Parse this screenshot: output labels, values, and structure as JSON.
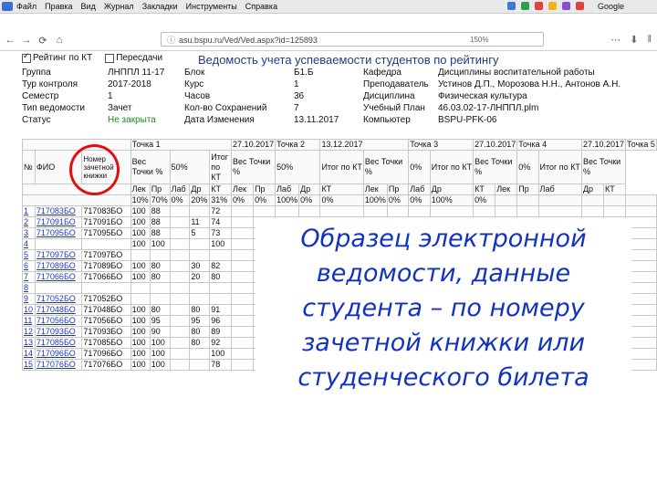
{
  "browser": {
    "menu": [
      "Файл",
      "Правка",
      "Вид",
      "Журнал",
      "Закладки",
      "Инструменты",
      "Справка"
    ],
    "tray_colors": [
      "#3b7bd8",
      "#2aa24a",
      "#e34040",
      "#f2b01e",
      "#8a4fd0",
      "#e34040"
    ],
    "search_label": "Google",
    "url": "asu.bspu.ru/Ved/Ved.aspx?id=125893",
    "url_right": "150%"
  },
  "sheet": {
    "filter_rating": "Рейтинг по КТ",
    "filter_retake": "Пересдачи",
    "title": "Ведомость учета успеваемости студентов по рейтингу",
    "info": [
      [
        "Группа",
        "ЛНППЛ 11-17",
        "Блок",
        "Б1.Б",
        "Кафедра",
        "Дисциплины воспитательной работы"
      ],
      [
        "Тур контроля",
        "2017-2018",
        "Курс",
        "1",
        "Преподаватель",
        "Устинов Д.П., Морозова Н.Н., Антонов А.Н."
      ],
      [
        "Семестр",
        "1",
        "Часов",
        "36",
        "Дисциплина",
        "Физическая культура"
      ],
      [
        "Тип ведомости",
        "Зачет",
        "Кол-во Сохранений",
        "7",
        "Учебный План",
        "46.03.02-17-ЛНППЛ.plm"
      ],
      [
        "Статус",
        "Не закрыта",
        "Дата Изменения",
        "13.11.2017",
        "Компьютер",
        "BSPU-PFK-06"
      ]
    ]
  },
  "table": {
    "point_row": [
      "Точка 1",
      "27.10.2017",
      "Точка 2",
      "13.12.2017",
      "Точка 3",
      "27.10.2017",
      "Точка 4",
      "27.10.2017",
      "Точка 5"
    ],
    "h_num": "№",
    "h_fio": "ФИО",
    "h_zach": "Номер зачетной книжки",
    "h_ves": "Вес Точки %",
    "h_50": "50%",
    "h_itog": "Итог по КТ",
    "h_0": "0%",
    "h_kt": "КТ",
    "sub": [
      "Лек",
      "Пр",
      "Лаб",
      "Др"
    ],
    "pct": [
      "10%",
      "70%",
      "0%",
      "20%",
      "31%",
      "0%",
      "0%",
      "100%",
      "0%",
      "0%",
      "100%",
      "0%",
      "0%",
      "100%",
      "0%"
    ],
    "rows": [
      [
        "1",
        "717083БО",
        "717083БО",
        "100",
        "88",
        "",
        "72"
      ],
      [
        "2",
        "717091БО",
        "717091БО",
        "100",
        "88",
        "11",
        "74"
      ],
      [
        "3",
        "717095БО",
        "717095БО",
        "100",
        "88",
        "5",
        "73"
      ],
      [
        "4",
        "",
        "",
        "100",
        "100",
        "",
        "100"
      ],
      [
        "5",
        "717097БО",
        "717097БО",
        "",
        "",
        "",
        ""
      ],
      [
        "6",
        "717089БО",
        "717089БО",
        "100",
        "80",
        "30",
        "82"
      ],
      [
        "7",
        "717066БО",
        "717066БО",
        "100",
        "80",
        "20",
        "80"
      ],
      [
        "8",
        "",
        "",
        "",
        "",
        "",
        ""
      ],
      [
        "9",
        "717052БО",
        "717052БО",
        "",
        "",
        "",
        ""
      ],
      [
        "10",
        "717048БО",
        "717048БО",
        "100",
        "80",
        "80",
        "91"
      ],
      [
        "11",
        "717056БО",
        "717056БО",
        "100",
        "95",
        "95",
        "96"
      ],
      [
        "12",
        "717093БО",
        "717093БО",
        "100",
        "90",
        "80",
        "89"
      ],
      [
        "13",
        "717085БО",
        "717085БО",
        "100",
        "100",
        "80",
        "92"
      ],
      [
        "14",
        "717096БО",
        "717096БО",
        "100",
        "100",
        "",
        "100"
      ],
      [
        "15",
        "717076БО",
        "717076БО",
        "100",
        "100",
        "",
        "78"
      ]
    ]
  },
  "overlay_lines": [
    "Образец электронной",
    "ведомости, данные",
    "студента – по номеру",
    "зачетной книжки или",
    "студенческого билета"
  ]
}
